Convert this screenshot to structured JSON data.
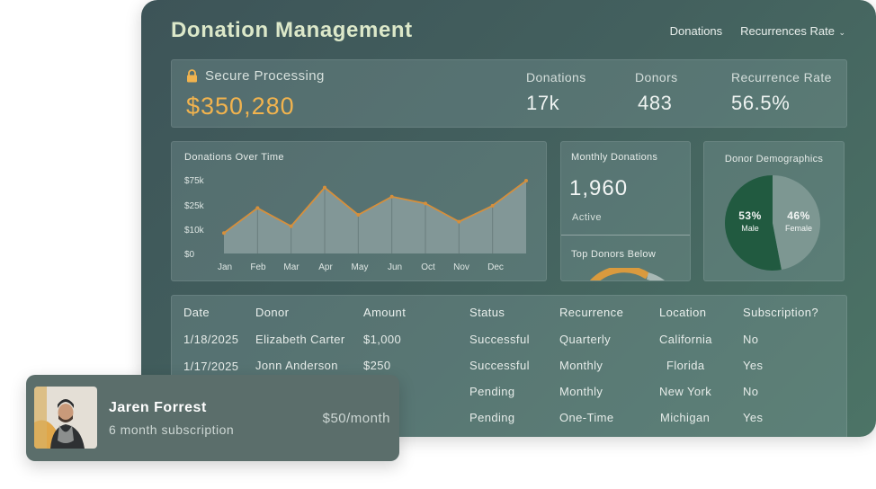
{
  "app": {
    "title": "Donation Management"
  },
  "nav": {
    "donations": "Donations",
    "recurrences": "Recurrences Rate"
  },
  "summary": {
    "secure_label": "Secure Processing",
    "total": "$350,280",
    "stats": [
      {
        "label": "Donations",
        "value": "17k"
      },
      {
        "label": "Donors",
        "value": "483"
      },
      {
        "label": "Recurrence Rate",
        "value": "56.5%"
      }
    ]
  },
  "chart_data": {
    "type": "area",
    "title": "Donations Over Time",
    "xlabel": "",
    "ylabel": "",
    "x_ticks": [
      "Jan",
      "Feb",
      "Mar",
      "Apr",
      "May",
      "Jun",
      "Oct",
      "Nov",
      "Dec"
    ],
    "y_ticks": [
      "$0",
      "$10k",
      "$25k",
      "$75k"
    ],
    "series": [
      {
        "values": [
          9,
          20,
          12,
          29,
          17,
          25,
          22,
          14,
          21,
          32
        ]
      }
    ],
    "grid": false,
    "colors": {
      "line": "#d68f3b",
      "fill": "#8a9e9d"
    }
  },
  "monthly": {
    "title": "Monthly Donations",
    "value": "1,960",
    "active": "Active",
    "top_donors": "Top Donors Below"
  },
  "demographics": {
    "title": "Donor Demographics",
    "male": {
      "pct": "53%",
      "label": "Male",
      "value": 53,
      "color": "#215a40"
    },
    "female": {
      "pct": "46%",
      "label": "Female",
      "value": 47,
      "color": "#7d9792"
    }
  },
  "table": {
    "headers": [
      "Date",
      "Donor",
      "Amount",
      "Status",
      "Recurrence",
      "Location",
      "Subscription?"
    ],
    "rows": [
      [
        "1/18/2025",
        "Elizabeth Carter",
        "$1,000",
        "Successful",
        "Quarterly",
        "California",
        "No"
      ],
      [
        "1/17/2025",
        "Jonn Anderson",
        "$250",
        "Successful",
        "Monthly",
        "Florida",
        "Yes"
      ],
      [
        "",
        "",
        "",
        "Pending",
        "Monthly",
        "New York",
        "No"
      ],
      [
        "",
        "",
        "",
        "Pending",
        "One-Time",
        "Michigan",
        "Yes"
      ]
    ]
  },
  "user_card": {
    "name": "Jaren Forrest",
    "subtitle": "6 month subscription",
    "amount": "$50/month"
  },
  "colors": {
    "accent": "#f1b34e",
    "title": "#dce8c9"
  }
}
